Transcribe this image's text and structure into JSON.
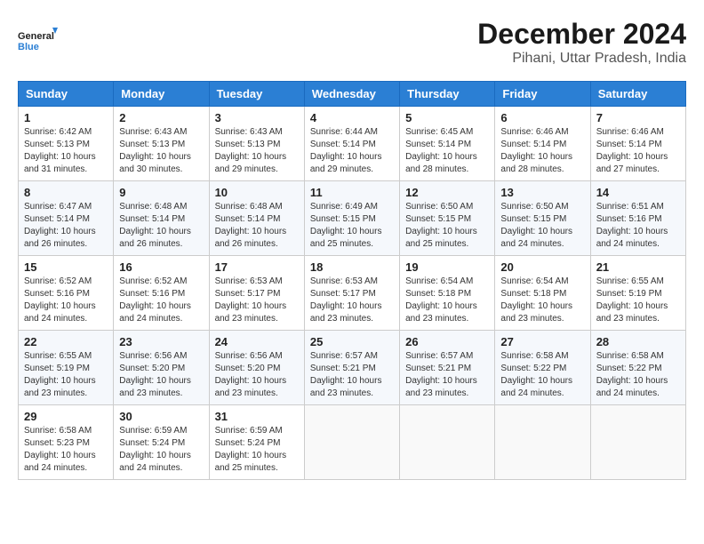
{
  "logo": {
    "line1": "General",
    "line2": "Blue"
  },
  "title": "December 2024",
  "subtitle": "Pihani, Uttar Pradesh, India",
  "days_of_week": [
    "Sunday",
    "Monday",
    "Tuesday",
    "Wednesday",
    "Thursday",
    "Friday",
    "Saturday"
  ],
  "weeks": [
    [
      {
        "day": "1",
        "sunrise": "Sunrise: 6:42 AM",
        "sunset": "Sunset: 5:13 PM",
        "daylight": "Daylight: 10 hours and 31 minutes."
      },
      {
        "day": "2",
        "sunrise": "Sunrise: 6:43 AM",
        "sunset": "Sunset: 5:13 PM",
        "daylight": "Daylight: 10 hours and 30 minutes."
      },
      {
        "day": "3",
        "sunrise": "Sunrise: 6:43 AM",
        "sunset": "Sunset: 5:13 PM",
        "daylight": "Daylight: 10 hours and 29 minutes."
      },
      {
        "day": "4",
        "sunrise": "Sunrise: 6:44 AM",
        "sunset": "Sunset: 5:14 PM",
        "daylight": "Daylight: 10 hours and 29 minutes."
      },
      {
        "day": "5",
        "sunrise": "Sunrise: 6:45 AM",
        "sunset": "Sunset: 5:14 PM",
        "daylight": "Daylight: 10 hours and 28 minutes."
      },
      {
        "day": "6",
        "sunrise": "Sunrise: 6:46 AM",
        "sunset": "Sunset: 5:14 PM",
        "daylight": "Daylight: 10 hours and 28 minutes."
      },
      {
        "day": "7",
        "sunrise": "Sunrise: 6:46 AM",
        "sunset": "Sunset: 5:14 PM",
        "daylight": "Daylight: 10 hours and 27 minutes."
      }
    ],
    [
      {
        "day": "8",
        "sunrise": "Sunrise: 6:47 AM",
        "sunset": "Sunset: 5:14 PM",
        "daylight": "Daylight: 10 hours and 26 minutes."
      },
      {
        "day": "9",
        "sunrise": "Sunrise: 6:48 AM",
        "sunset": "Sunset: 5:14 PM",
        "daylight": "Daylight: 10 hours and 26 minutes."
      },
      {
        "day": "10",
        "sunrise": "Sunrise: 6:48 AM",
        "sunset": "Sunset: 5:14 PM",
        "daylight": "Daylight: 10 hours and 26 minutes."
      },
      {
        "day": "11",
        "sunrise": "Sunrise: 6:49 AM",
        "sunset": "Sunset: 5:15 PM",
        "daylight": "Daylight: 10 hours and 25 minutes."
      },
      {
        "day": "12",
        "sunrise": "Sunrise: 6:50 AM",
        "sunset": "Sunset: 5:15 PM",
        "daylight": "Daylight: 10 hours and 25 minutes."
      },
      {
        "day": "13",
        "sunrise": "Sunrise: 6:50 AM",
        "sunset": "Sunset: 5:15 PM",
        "daylight": "Daylight: 10 hours and 24 minutes."
      },
      {
        "day": "14",
        "sunrise": "Sunrise: 6:51 AM",
        "sunset": "Sunset: 5:16 PM",
        "daylight": "Daylight: 10 hours and 24 minutes."
      }
    ],
    [
      {
        "day": "15",
        "sunrise": "Sunrise: 6:52 AM",
        "sunset": "Sunset: 5:16 PM",
        "daylight": "Daylight: 10 hours and 24 minutes."
      },
      {
        "day": "16",
        "sunrise": "Sunrise: 6:52 AM",
        "sunset": "Sunset: 5:16 PM",
        "daylight": "Daylight: 10 hours and 24 minutes."
      },
      {
        "day": "17",
        "sunrise": "Sunrise: 6:53 AM",
        "sunset": "Sunset: 5:17 PM",
        "daylight": "Daylight: 10 hours and 23 minutes."
      },
      {
        "day": "18",
        "sunrise": "Sunrise: 6:53 AM",
        "sunset": "Sunset: 5:17 PM",
        "daylight": "Daylight: 10 hours and 23 minutes."
      },
      {
        "day": "19",
        "sunrise": "Sunrise: 6:54 AM",
        "sunset": "Sunset: 5:18 PM",
        "daylight": "Daylight: 10 hours and 23 minutes."
      },
      {
        "day": "20",
        "sunrise": "Sunrise: 6:54 AM",
        "sunset": "Sunset: 5:18 PM",
        "daylight": "Daylight: 10 hours and 23 minutes."
      },
      {
        "day": "21",
        "sunrise": "Sunrise: 6:55 AM",
        "sunset": "Sunset: 5:19 PM",
        "daylight": "Daylight: 10 hours and 23 minutes."
      }
    ],
    [
      {
        "day": "22",
        "sunrise": "Sunrise: 6:55 AM",
        "sunset": "Sunset: 5:19 PM",
        "daylight": "Daylight: 10 hours and 23 minutes."
      },
      {
        "day": "23",
        "sunrise": "Sunrise: 6:56 AM",
        "sunset": "Sunset: 5:20 PM",
        "daylight": "Daylight: 10 hours and 23 minutes."
      },
      {
        "day": "24",
        "sunrise": "Sunrise: 6:56 AM",
        "sunset": "Sunset: 5:20 PM",
        "daylight": "Daylight: 10 hours and 23 minutes."
      },
      {
        "day": "25",
        "sunrise": "Sunrise: 6:57 AM",
        "sunset": "Sunset: 5:21 PM",
        "daylight": "Daylight: 10 hours and 23 minutes."
      },
      {
        "day": "26",
        "sunrise": "Sunrise: 6:57 AM",
        "sunset": "Sunset: 5:21 PM",
        "daylight": "Daylight: 10 hours and 23 minutes."
      },
      {
        "day": "27",
        "sunrise": "Sunrise: 6:58 AM",
        "sunset": "Sunset: 5:22 PM",
        "daylight": "Daylight: 10 hours and 24 minutes."
      },
      {
        "day": "28",
        "sunrise": "Sunrise: 6:58 AM",
        "sunset": "Sunset: 5:22 PM",
        "daylight": "Daylight: 10 hours and 24 minutes."
      }
    ],
    [
      {
        "day": "29",
        "sunrise": "Sunrise: 6:58 AM",
        "sunset": "Sunset: 5:23 PM",
        "daylight": "Daylight: 10 hours and 24 minutes."
      },
      {
        "day": "30",
        "sunrise": "Sunrise: 6:59 AM",
        "sunset": "Sunset: 5:24 PM",
        "daylight": "Daylight: 10 hours and 24 minutes."
      },
      {
        "day": "31",
        "sunrise": "Sunrise: 6:59 AM",
        "sunset": "Sunset: 5:24 PM",
        "daylight": "Daylight: 10 hours and 25 minutes."
      },
      null,
      null,
      null,
      null
    ]
  ]
}
